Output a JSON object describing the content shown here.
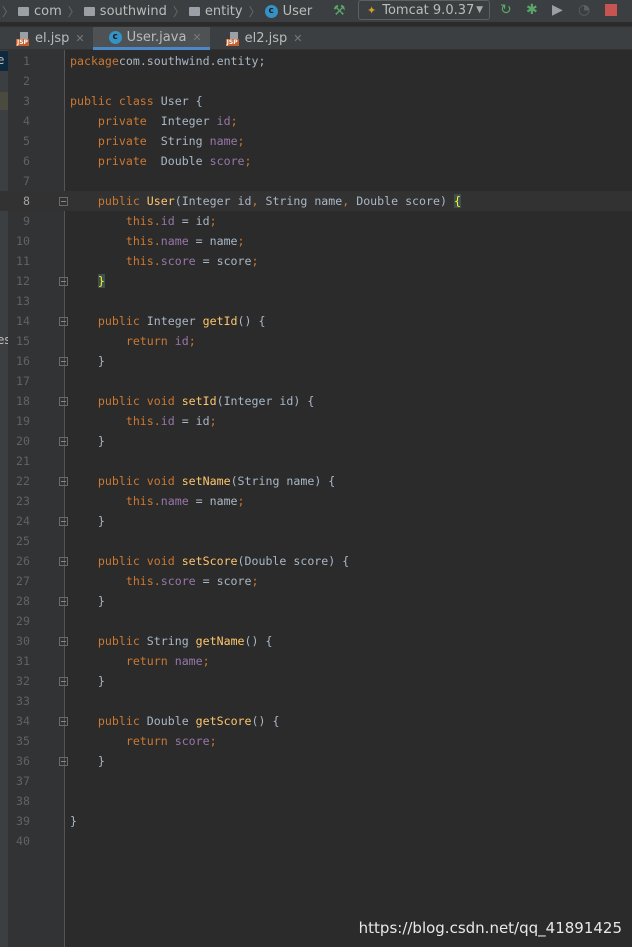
{
  "breadcrumb": [
    "com",
    "southwind",
    "entity",
    "User"
  ],
  "run_config": "Tomcat 9.0.37",
  "tabs": [
    {
      "label": "el.jsp",
      "icon": "jsp-icon"
    },
    {
      "label": "User.java",
      "icon": "class-icon",
      "active": true
    },
    {
      "label": "el2.jsp",
      "icon": "jsp-icon"
    }
  ],
  "left_strip": [
    "e",
    "es"
  ],
  "current_line": 8,
  "fold_lines": [
    8,
    12,
    14,
    16,
    18,
    20,
    22,
    24,
    26,
    28,
    30,
    32,
    34,
    36
  ],
  "code": [
    [
      [
        "kw",
        "package"
      ],
      [
        "",
        "com.southwind.entity;"
      ]
    ],
    [],
    [
      [
        "kw",
        "public class "
      ],
      [
        "",
        "User {"
      ]
    ],
    [
      [
        "",
        "    "
      ],
      [
        "kw",
        "private  "
      ],
      [
        "",
        "Integer "
      ],
      [
        "fd",
        "id"
      ],
      [
        "kw",
        ";"
      ]
    ],
    [
      [
        "",
        "    "
      ],
      [
        "kw",
        "private  "
      ],
      [
        "",
        "String "
      ],
      [
        "fd",
        "name"
      ],
      [
        "kw",
        ";"
      ]
    ],
    [
      [
        "",
        "    "
      ],
      [
        "kw",
        "private  "
      ],
      [
        "",
        "Double "
      ],
      [
        "fd",
        "score"
      ],
      [
        "kw",
        ";"
      ]
    ],
    [],
    [
      [
        "",
        "    "
      ],
      [
        "kw",
        "public "
      ],
      [
        "fn",
        "User"
      ],
      [
        "",
        "(Integer id"
      ],
      [
        "kw",
        ", "
      ],
      [
        "",
        "String name"
      ],
      [
        "kw",
        ", "
      ],
      [
        "",
        "Double score) "
      ],
      [
        "br",
        "{"
      ]
    ],
    [
      [
        "",
        "        "
      ],
      [
        "kw",
        "this."
      ],
      [
        "fd",
        "id"
      ],
      [
        "",
        " = id"
      ],
      [
        "kw",
        ";"
      ]
    ],
    [
      [
        "",
        "        "
      ],
      [
        "kw",
        "this."
      ],
      [
        "fd",
        "name"
      ],
      [
        "",
        " = name"
      ],
      [
        "kw",
        ";"
      ]
    ],
    [
      [
        "",
        "        "
      ],
      [
        "kw",
        "this."
      ],
      [
        "fd",
        "score"
      ],
      [
        "",
        " = score"
      ],
      [
        "kw",
        ";"
      ]
    ],
    [
      [
        "",
        "    "
      ],
      [
        "br",
        "}"
      ]
    ],
    [],
    [
      [
        "",
        "    "
      ],
      [
        "kw",
        "public "
      ],
      [
        "",
        "Integer "
      ],
      [
        "fn",
        "getId"
      ],
      [
        "",
        "() {"
      ]
    ],
    [
      [
        "",
        "        "
      ],
      [
        "kw",
        "return "
      ],
      [
        "fd",
        "id"
      ],
      [
        "kw",
        ";"
      ]
    ],
    [
      [
        "",
        "    }"
      ]
    ],
    [],
    [
      [
        "",
        "    "
      ],
      [
        "kw",
        "public void "
      ],
      [
        "fn",
        "setId"
      ],
      [
        "",
        "(Integer id) {"
      ]
    ],
    [
      [
        "",
        "        "
      ],
      [
        "kw",
        "this."
      ],
      [
        "fd",
        "id"
      ],
      [
        "",
        " = id"
      ],
      [
        "kw",
        ";"
      ]
    ],
    [
      [
        "",
        "    }"
      ]
    ],
    [],
    [
      [
        "",
        "    "
      ],
      [
        "kw",
        "public void "
      ],
      [
        "fn",
        "setName"
      ],
      [
        "",
        "(String name) {"
      ]
    ],
    [
      [
        "",
        "        "
      ],
      [
        "kw",
        "this."
      ],
      [
        "fd",
        "name"
      ],
      [
        "",
        " = name"
      ],
      [
        "kw",
        ";"
      ]
    ],
    [
      [
        "",
        "    }"
      ]
    ],
    [],
    [
      [
        "",
        "    "
      ],
      [
        "kw",
        "public void "
      ],
      [
        "fn",
        "setScore"
      ],
      [
        "",
        "(Double score) {"
      ]
    ],
    [
      [
        "",
        "        "
      ],
      [
        "kw",
        "this."
      ],
      [
        "fd",
        "score"
      ],
      [
        "",
        " = score"
      ],
      [
        "kw",
        ";"
      ]
    ],
    [
      [
        "",
        "    }"
      ]
    ],
    [],
    [
      [
        "",
        "    "
      ],
      [
        "kw",
        "public "
      ],
      [
        "",
        "String "
      ],
      [
        "fn",
        "getName"
      ],
      [
        "",
        "() {"
      ]
    ],
    [
      [
        "",
        "        "
      ],
      [
        "kw",
        "return "
      ],
      [
        "fd",
        "name"
      ],
      [
        "kw",
        ";"
      ]
    ],
    [
      [
        "",
        "    }"
      ]
    ],
    [],
    [
      [
        "",
        "    "
      ],
      [
        "kw",
        "public "
      ],
      [
        "",
        "Double "
      ],
      [
        "fn",
        "getScore"
      ],
      [
        "",
        "() {"
      ]
    ],
    [
      [
        "",
        "        "
      ],
      [
        "kw",
        "return "
      ],
      [
        "fd",
        "score"
      ],
      [
        "kw",
        ";"
      ]
    ],
    [
      [
        "",
        "    }"
      ]
    ],
    [],
    [],
    [
      [
        "",
        "}"
      ]
    ],
    []
  ],
  "watermark": "https://blog.csdn.net/qq_41891425"
}
